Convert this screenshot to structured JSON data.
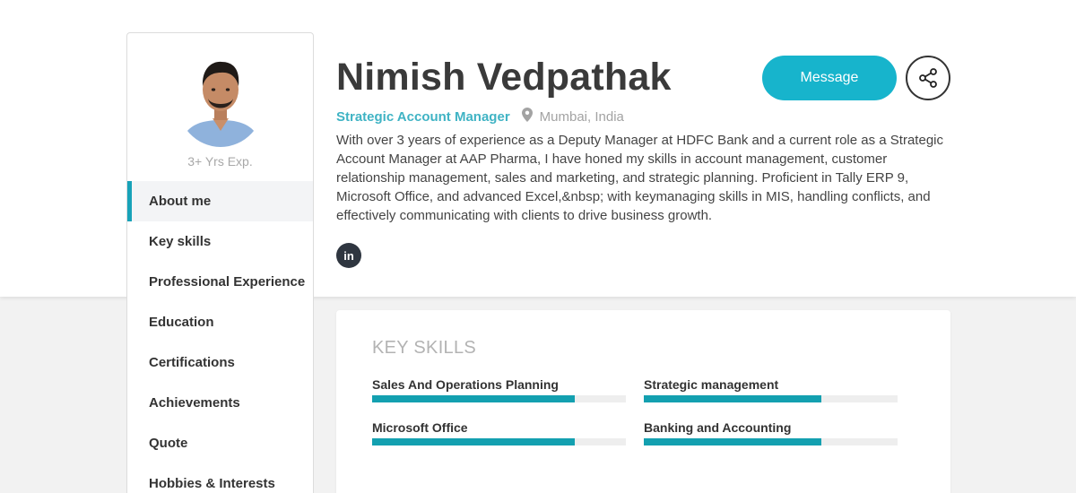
{
  "profile": {
    "name": "Nimish Vedpathak",
    "role": "Strategic Account Manager",
    "location": "Mumbai, India",
    "experience": "3+ Yrs Exp.",
    "bio": "With over 3 years of experience as a Deputy Manager at HDFC Bank and a current role as a Strategic Account Manager at AAP Pharma, I have honed my skills in account management, customer relationship management, sales and marketing, and strategic planning. Proficient in Tally ERP 9, Microsoft Office, and advanced Excel,&nbsp; with keymanaging skills in MIS, handling conflicts, and effectively communicating with clients to drive business growth.",
    "linkedin_label": "in"
  },
  "actions": {
    "message_label": "Message",
    "share_icon": "share-icon"
  },
  "sidebar": {
    "items": [
      {
        "label": "About me",
        "active": true
      },
      {
        "label": "Key skills",
        "active": false
      },
      {
        "label": "Professional Experience",
        "active": false
      },
      {
        "label": "Education",
        "active": false
      },
      {
        "label": "Certifications",
        "active": false
      },
      {
        "label": "Achievements",
        "active": false
      },
      {
        "label": "Quote",
        "active": false
      },
      {
        "label": "Hobbies & Interests",
        "active": false
      }
    ]
  },
  "skills": {
    "title": "KEY SKILLS",
    "items": [
      {
        "name": "Sales And Operations Planning",
        "level": 0.8
      },
      {
        "name": "Strategic management",
        "level": 0.7
      },
      {
        "name": "Microsoft Office",
        "level": 0.8
      },
      {
        "name": "Banking and Accounting",
        "level": 0.7
      }
    ]
  },
  "colors": {
    "accent": "#17b4cc",
    "bar_fill": "#13a0b0",
    "role_text": "#3fb3c4"
  }
}
